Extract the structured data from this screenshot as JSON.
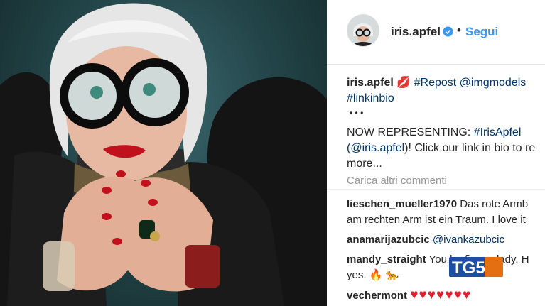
{
  "post": {
    "username": "iris.apfel",
    "follow_label": "Segui",
    "separator": "•"
  },
  "caption": {
    "username": "iris.apfel",
    "lips": "💋",
    "repost_tag": "#Repost @imgmodels",
    "link_tag": "#linkinbio",
    "dots": "• • •",
    "line4_text": "NOW REPRESENTING: ",
    "line4_tag": "#IrisApfel",
    "line5_tag": "(@iris.apfel",
    "line5_text": ")! Click our link in bio to re",
    "more": "more..."
  },
  "load_more": "Carica altri commenti",
  "comments": [
    {
      "user": "lieschen_mueller1970",
      "text": "Das rote Armb",
      "text2": "am rechten Arm ist ein Traum. I love it"
    },
    {
      "user": "anamarijazubcic",
      "text": "@ivankazubcic"
    },
    {
      "user": "mandy_straight",
      "text": "You be fierce, lady. H",
      "text2": "yes. 🔥 🐆"
    },
    {
      "user": "vechermont",
      "text": "♥♥♥♥♥♥♥"
    }
  ],
  "broadcast": {
    "logo": "TG5"
  },
  "colors": {
    "link": "#3897f0",
    "tag": "#003569",
    "verified": "#3897f0",
    "muted": "#999999"
  }
}
